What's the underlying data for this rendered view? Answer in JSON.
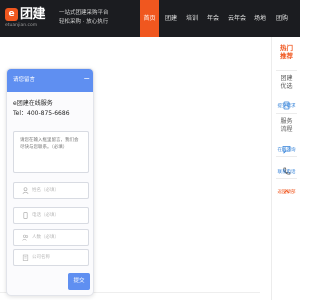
{
  "header": {
    "logo_mark": "e",
    "logo_text": "团建",
    "logo_sub": "etuanjian.com",
    "slogan_line1": "一站式团建采购平台",
    "slogan_line2": "轻松采购 · 放心执行",
    "nav": [
      "首页",
      "团建",
      "培训",
      "年会",
      "云年会",
      "场地",
      "团购"
    ],
    "accent_color": "#f0571f"
  },
  "dialog": {
    "title": "请您留言",
    "close_icon": "close-icon",
    "service_title": "e团建在线服务",
    "service_tel": "Tel：400-875-6686",
    "message_placeholder": "请您在输入框里留言，我们会尽快与您联系。（必填）",
    "fields": [
      {
        "icon": "user-icon",
        "placeholder": "姓名（必填）"
      },
      {
        "icon": "phone-icon",
        "placeholder": "电话（必填）"
      },
      {
        "icon": "people-icon",
        "placeholder": "人数（必填）"
      },
      {
        "icon": "company-icon",
        "placeholder": "公司名称"
      }
    ],
    "submit_label": "提交",
    "header_color": "#5f8ff1"
  },
  "sidebar": {
    "hot_label": "热门推荐",
    "item1": "团建优选",
    "item1_sub": "提交需求",
    "item2": "服务流程",
    "item2_sub": "在线咨询",
    "item3_sub": "联系电话",
    "bottom_label": "返回顶部"
  }
}
